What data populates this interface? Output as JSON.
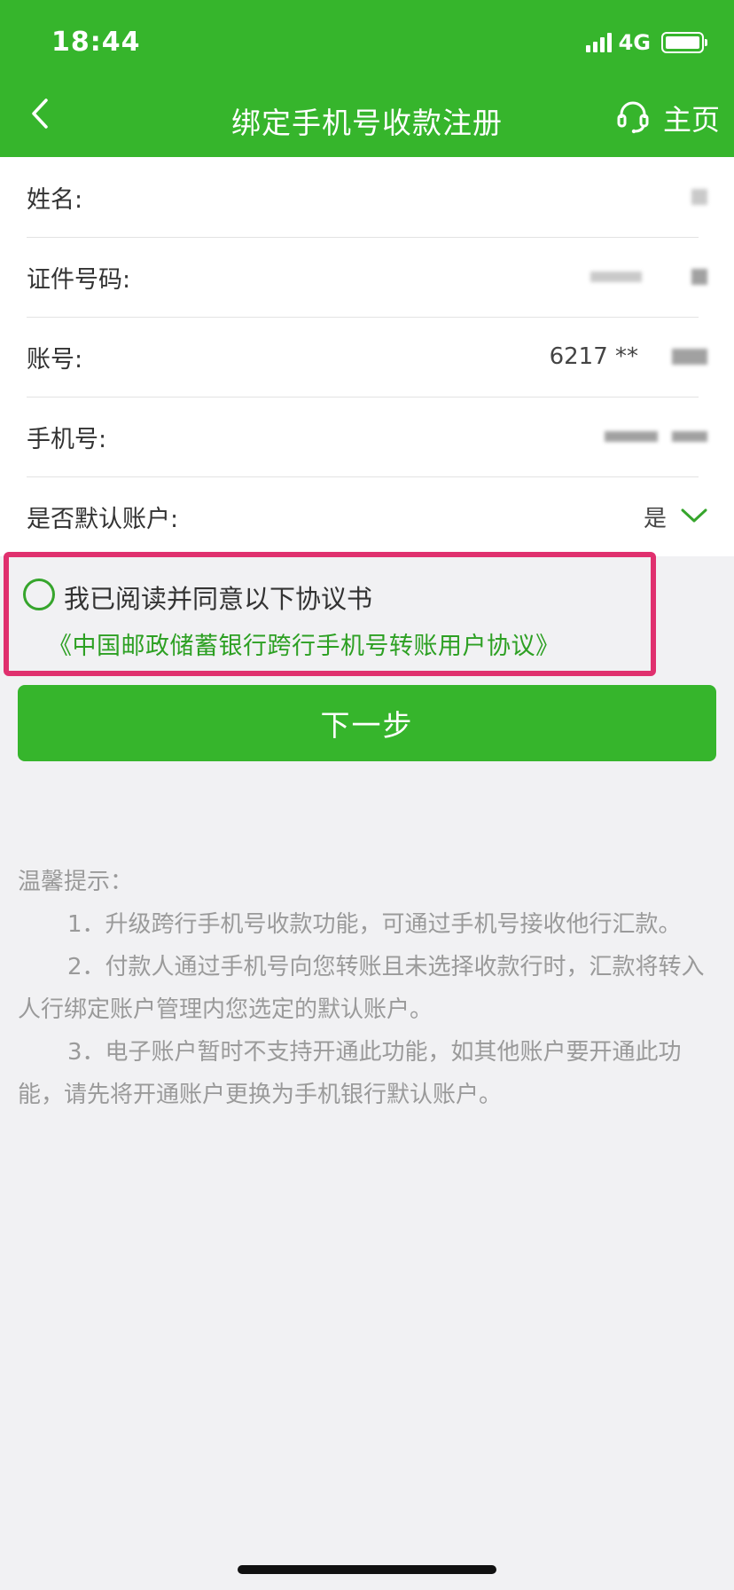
{
  "status_bar": {
    "time": "18:44",
    "network": "4G"
  },
  "nav": {
    "title": "绑定手机号收款注册",
    "home_label": "主页"
  },
  "form": {
    "rows": [
      {
        "label": "姓名:",
        "value": ""
      },
      {
        "label": "证件号码:",
        "value": ""
      },
      {
        "label": "账号:",
        "value": "6217 **"
      },
      {
        "label": "手机号:",
        "value": ""
      },
      {
        "label": "是否默认账户:",
        "value": "是"
      }
    ]
  },
  "agreement": {
    "consent_text": "我已阅读并同意以下协议书",
    "link_text": "《中国邮政储蓄银行跨行手机号转账用户协议》"
  },
  "next_button": {
    "label": "下一步"
  },
  "tips": {
    "title": "温馨提示：",
    "items": [
      "1．升级跨行手机号收款功能，可通过手机号接收他行汇款。",
      "2．付款人通过手机号向您转账且未选择收款行时，汇款将转入人行绑定账户管理内您选定的默认账户。",
      "3．电子账户暂时不支持开通此功能，如其他账户要开通此功能，请先将开通账户更换为手机银行默认账户。"
    ]
  },
  "colors": {
    "brand_green": "#36b52c",
    "highlight_border": "#e0306e",
    "link_green": "#2da023"
  }
}
